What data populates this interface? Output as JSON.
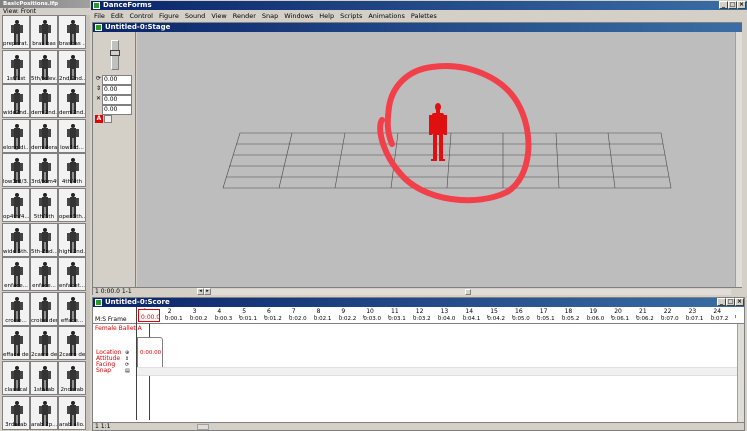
{
  "palette": {
    "title": "BasicPositions.lfp",
    "view_label": "View: Front",
    "items": [
      {
        "label": "preparat..."
      },
      {
        "label": "bras bas"
      },
      {
        "label": "brasbas ..."
      },
      {
        "label": "1st/1st"
      },
      {
        "label": "5th/relev..."
      },
      {
        "label": "2nd/2nd..."
      },
      {
        "label": "wide2nd..."
      },
      {
        "label": "demi2nd..."
      },
      {
        "label": "demi2nd..."
      },
      {
        "label": "elong.di..."
      },
      {
        "label": "demidera..."
      },
      {
        "label": "low3rd..."
      },
      {
        "label": "low3rd/3..."
      },
      {
        "label": "3rd/rom4th"
      },
      {
        "label": "4th/4th"
      },
      {
        "label": "op4th/4..."
      },
      {
        "label": "5th/5th"
      },
      {
        "label": "open5th..."
      },
      {
        "label": "wide 5th..."
      },
      {
        "label": "5th-2nd..."
      },
      {
        "label": "high 2nd..."
      },
      {
        "label": "enface..."
      },
      {
        "label": "enface..."
      },
      {
        "label": "enfacet..."
      },
      {
        "label": "croise..."
      },
      {
        "label": "croise der..."
      },
      {
        "label": "efface..."
      },
      {
        "label": "efface der..."
      },
      {
        "label": "2carre de..."
      },
      {
        "label": "2carre de..."
      },
      {
        "label": "classical"
      },
      {
        "label": "1starab"
      },
      {
        "label": "2ndarab"
      },
      {
        "label": "3rdarab"
      },
      {
        "label": "arab 2p..."
      },
      {
        "label": "arab alio..."
      }
    ]
  },
  "app": {
    "title": "DanceForms",
    "menu": [
      "File",
      "Edit",
      "Control",
      "Figure",
      "Sound",
      "View",
      "Render",
      "Snap",
      "Windows",
      "Help",
      "Scripts",
      "Animations",
      "Palettes"
    ]
  },
  "stage": {
    "title": "Untitled-0:Stage",
    "fields": [
      "0.00",
      "0.00",
      "0.00",
      "0.00"
    ],
    "status": "1 0:00.0 1-1"
  },
  "score": {
    "title": "Untitled-0:Score",
    "ms_frame_label": "M:S Frame",
    "current_time": "0:00.0",
    "dancer_name": "Female Ballet A",
    "frames": [
      "1",
      "2",
      "3",
      "4",
      "5",
      "6",
      "7",
      "8",
      "9",
      "10",
      "11",
      "12",
      "13",
      "14",
      "15",
      "16",
      "17",
      "18",
      "19",
      "20",
      "21",
      "22",
      "23",
      "24"
    ],
    "times": [
      "0:00.1",
      "0:00.2",
      "0:00.3",
      "0:01.1",
      "0:01.2",
      "0:02.0",
      "0:02.1",
      "0:02.2",
      "0:03.0",
      "0:03.1",
      "0:03.2",
      "0:04.0",
      "0:04.1",
      "0:04.2",
      "0:05.0",
      "0:05.1",
      "0:05.2",
      "0:06.0",
      "0:06.1",
      "0:06.2",
      "0:07.0",
      "0:07.1",
      "0:07.2"
    ],
    "properties": [
      "Location",
      "Attitude",
      "Facing",
      "Snap"
    ],
    "key_label": "0:00.00",
    "status": "1 1:1"
  },
  "colors": {
    "title_bar": "#0a246a",
    "highlight": "#e00000",
    "canvas": "#bdbdbd"
  }
}
